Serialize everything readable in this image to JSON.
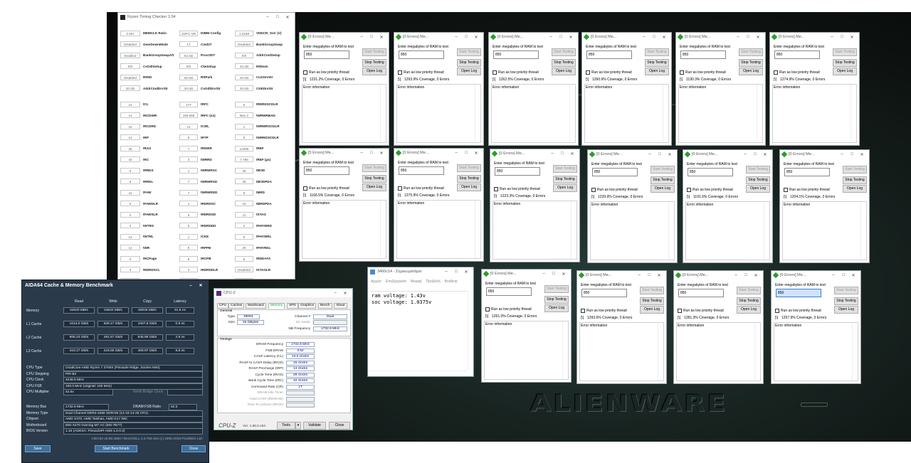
{
  "rtc": {
    "title": "Ryzen Timing Checker 1.04",
    "top_rows": [
      [
        "3.467",
        "MEMCLK Ratio",
        "1DPC-SR",
        "DIMM Config",
        "1.0188",
        "VDDCR_SoC (V)"
      ],
      [
        "Disabled",
        "GearDownMode",
        "1T",
        "Cmd2T",
        "Disabled",
        "BankGroupSwap"
      ],
      [
        "Enabled",
        "BankGroupSwapAlt",
        "53.3Ω",
        "ProcODT",
        "0/0",
        "AddrCmdSetup"
      ],
      [
        "0/0",
        "CsOdtSetup",
        "0/0",
        "CkeSetup",
        "34.3Ω",
        "RttNom"
      ],
      [
        "Disabled",
        "RttWr",
        "60.0Ω",
        "RttPark",
        "20.0Ω",
        "CLKDrvStr"
      ],
      [
        "20.0Ω",
        "AddrCmdDrvStr",
        "20.0Ω",
        "CsOdtDrvStr",
        "20.0Ω",
        "CKEDrvStr"
      ]
    ],
    "timing_rows": [
      [
        "14",
        "tCL",
        "277",
        "tRFC",
        "6",
        "tRDRDSCDLR"
      ],
      [
        "14",
        "tRCDWR",
        "159.688",
        "tRFC (ns)",
        "Ban 2",
        "tWRWRBAN"
      ],
      [
        "15",
        "tRCDRD",
        "14",
        "tCWL",
        "1",
        "tWRWRSCDLR"
      ],
      [
        "14",
        "tRP",
        "8",
        "tRTP",
        "0",
        "tWRRDSCDLR"
      ],
      [
        "28",
        "tRAS",
        "7",
        "tRDWR",
        "13495",
        "tREF"
      ],
      [
        "42",
        "tRC",
        "3",
        "tWRRD",
        "7.786",
        "tREF (µs)"
      ],
      [
        "5",
        "tRRDS",
        "1",
        "tWRWRSC",
        "26",
        "tMOD"
      ],
      [
        "8",
        "tRRDL",
        "7",
        "tWRWRSD",
        "26",
        "tMODPDA"
      ],
      [
        "41",
        "tFAW",
        "7",
        "tWRWRDD",
        "8",
        "tMRD"
      ],
      [
        "0",
        "tFAWDLR",
        "1",
        "tRDRDSC",
        "16",
        "tMRDPDA"
      ],
      [
        "0",
        "tFAWSLR",
        "5",
        "tRDRDSD",
        "11",
        "tSTAG"
      ],
      [
        "4",
        "tWTRS",
        "5",
        "tRDRDDD",
        "2",
        "tPHYWRD"
      ],
      [
        "12",
        "tWTRL",
        "1",
        "tCKE",
        "9",
        "tPHYWRL"
      ],
      [
        "12",
        "tWR",
        "8",
        "tRPPB",
        "26",
        "tPHYRDL"
      ],
      [
        "0",
        "tRCPage",
        "8",
        "tRCPB",
        "9",
        "tRDDATA"
      ],
      [
        "3",
        "tRDRDSCL",
        "3",
        "tRDRDDLR",
        "Disabled",
        "tSTAGLR"
      ],
      [
        "3",
        "tWRWRSCL",
        "Ban 2",
        "tRDRDBAN",
        "24",
        "tWRMPR"
      ]
    ]
  },
  "aida": {
    "title": "AIDA64 Cache & Memory Benchmark",
    "headers": [
      "Read",
      "Write",
      "Copy",
      "Latency"
    ],
    "rows": [
      {
        "label": "Memory",
        "v": [
          "54620 MB/s",
          "53632 MB/s",
          "50025 MB/s",
          "61.8 ns"
        ]
      },
      {
        "label": "L1 Cache",
        "v": [
          "1014.0 GB/s",
          "509.17 GB/s",
          "1007.8 GB/s",
          "0.9 ns"
        ]
      },
      {
        "label": "L2 Cache",
        "v": [
          "906.23 GB/s",
          "491.67 GB/s",
          "845.99 GB/s",
          "2.8 ns"
        ]
      },
      {
        "label": "L3 Cache",
        "v": [
          "419.17 GB/s",
          "419.00 GB/s",
          "409.97 GB/s",
          "8.8 ns"
        ]
      }
    ],
    "info": [
      {
        "label": "CPU Type",
        "value": "OctalCore AMD Ryzen 7 2700X  (Pinnacle Ridge, Socket AM4)"
      },
      {
        "label": "CPU Stepping",
        "value": "PiR-B2"
      },
      {
        "label": "CPU Clock",
        "value": "4248.9 MHz"
      },
      {
        "label": "CPU FSB",
        "value": "100.0 MHz  (original: 100 MHz)"
      },
      {
        "label": "CPU Multiplier",
        "value": "42.5x"
      }
    ],
    "nb_label": "North Bridge Clock",
    "info2": [
      {
        "label": "Memory Bus",
        "value": "1732.9 MHz"
      },
      {
        "label": "Memory Type",
        "value": "Dual Channel DDR4-3466 SDRAM  (14-15-14-28 CR1)"
      },
      {
        "label": "Chipset",
        "value": "AMD X470, AMD Taishan, AMD K17 IMC"
      },
      {
        "label": "Motherboard",
        "value": "MSI X470 Gaming M7 AC (MS-7B77)"
      },
      {
        "label": "BIOS Version",
        "value": "1.10  (AGESA: PinnaclePI-AM4 1.0.0.2)"
      }
    ],
    "dram_label": "DRAM:FSB Ratio",
    "dram_value": "52:3",
    "footer": "AIDA64 v5.98.4800 / BenchDLL 4.3.784-x64  (c) 1995-2018 FinalWire Ltd.",
    "buttons": {
      "save": "Save",
      "start": "Start Benchmark",
      "close": "Close"
    }
  },
  "cpuz": {
    "title": "CPU-Z",
    "tabs": [
      "CPU",
      "Caches",
      "Mainboard",
      "Memory",
      "SPD",
      "Graphics",
      "Bench",
      "About"
    ],
    "general_label": "General",
    "type_label": "Type",
    "type": "DDR4",
    "size_label": "Size",
    "size": "16 GBytes",
    "channel_label": "Channel #",
    "channel": "Dual",
    "dcmode_label": "DC Mode",
    "nbfreq_label": "NB Frequency",
    "nbfreq": "1732.9 MHz",
    "timings_label": "Timings",
    "timings": [
      {
        "label": "DRAM Frequency",
        "value": "1732.9 MHz"
      },
      {
        "label": "FSB:DRAM",
        "value": "3:52"
      },
      {
        "label": "CAS# Latency (CL)",
        "value": "14.0 clocks"
      },
      {
        "label": "RAS# to CAS# Delay (tRCD)",
        "value": "15 clocks"
      },
      {
        "label": "RAS# Precharge (tRP)",
        "value": "14 clocks"
      },
      {
        "label": "Cycle Time (tRAS)",
        "value": "28 clocks"
      },
      {
        "label": "Bank Cycle Time (tRC)",
        "value": "42 clocks"
      },
      {
        "label": "Command Rate (CR)",
        "value": "1T"
      }
    ],
    "timings_dim": [
      "DRAM Idle Timer",
      "Total CAS# (tRDRAM)",
      "Row To Column (tRCD)"
    ],
    "brand": "CPU-Z",
    "version": "Ver. 1.86.0.x64",
    "tools": "Tools",
    "validate": "Validate",
    "close": "Close"
  },
  "notepad": {
    "title": "3460c14 - Σημειωματάριο",
    "menu": [
      "Αρχείο",
      "Επεξεργασία",
      "Μορφή",
      "Προβολή",
      "Βοήθεια"
    ],
    "lines": [
      "ram voltage: 1.43v",
      "soc voltage: 1.0375v"
    ]
  },
  "memtest": {
    "title": "[0 Errors] Me...",
    "prompt": "Enter megabytes of RAM to test",
    "value": "850",
    "start": "Start Testing",
    "stop": "Stop Testing",
    "open": "Open Log",
    "low": "Run as low priority thread",
    "err": "Error information",
    "coverage": [
      "1231.2% Coverage, 0 Errors",
      "1293.9% Coverage, 0 Errors",
      "1262.5% Coverage, 0 Errors",
      "1260.9% Coverage, 0 Errors",
      "1190.3% Coverage, 0 Errors",
      "1274.9% Coverage, 0 Errors",
      "1166.5% Coverage, 0 Errors",
      "1275.9% Coverage, 0 Errors",
      "1223.3% Coverage, 0 Errors",
      "1239.9% Coverage, 0 Errors",
      "1191.6% Coverage, 0 Errors",
      "1204.1% Coverage, 0 Errors",
      "1261.0% Coverage, 0 Errors",
      "1293.6% Coverage, 0 Errors",
      "1281.3% Coverage, 0 Errors",
      "1257.9% Coverage, 0 Errors"
    ],
    "spinner": [
      "[\\]",
      "[\\]",
      "[\\]",
      "[\\]",
      "[\\]",
      "[\\]",
      "[\\]",
      "[\\]",
      "[\\]",
      "[\\]",
      "[\\]",
      "[\\]",
      "[\\]",
      "[\\]",
      "[\\]",
      "[\\]"
    ]
  },
  "desktop": {
    "brand": "ALIENWARE"
  },
  "colors": {
    "aida_bg": "#2b3a4a",
    "cpuz_value": "#0000aa",
    "memtest_icon": "#2a9d2a"
  }
}
